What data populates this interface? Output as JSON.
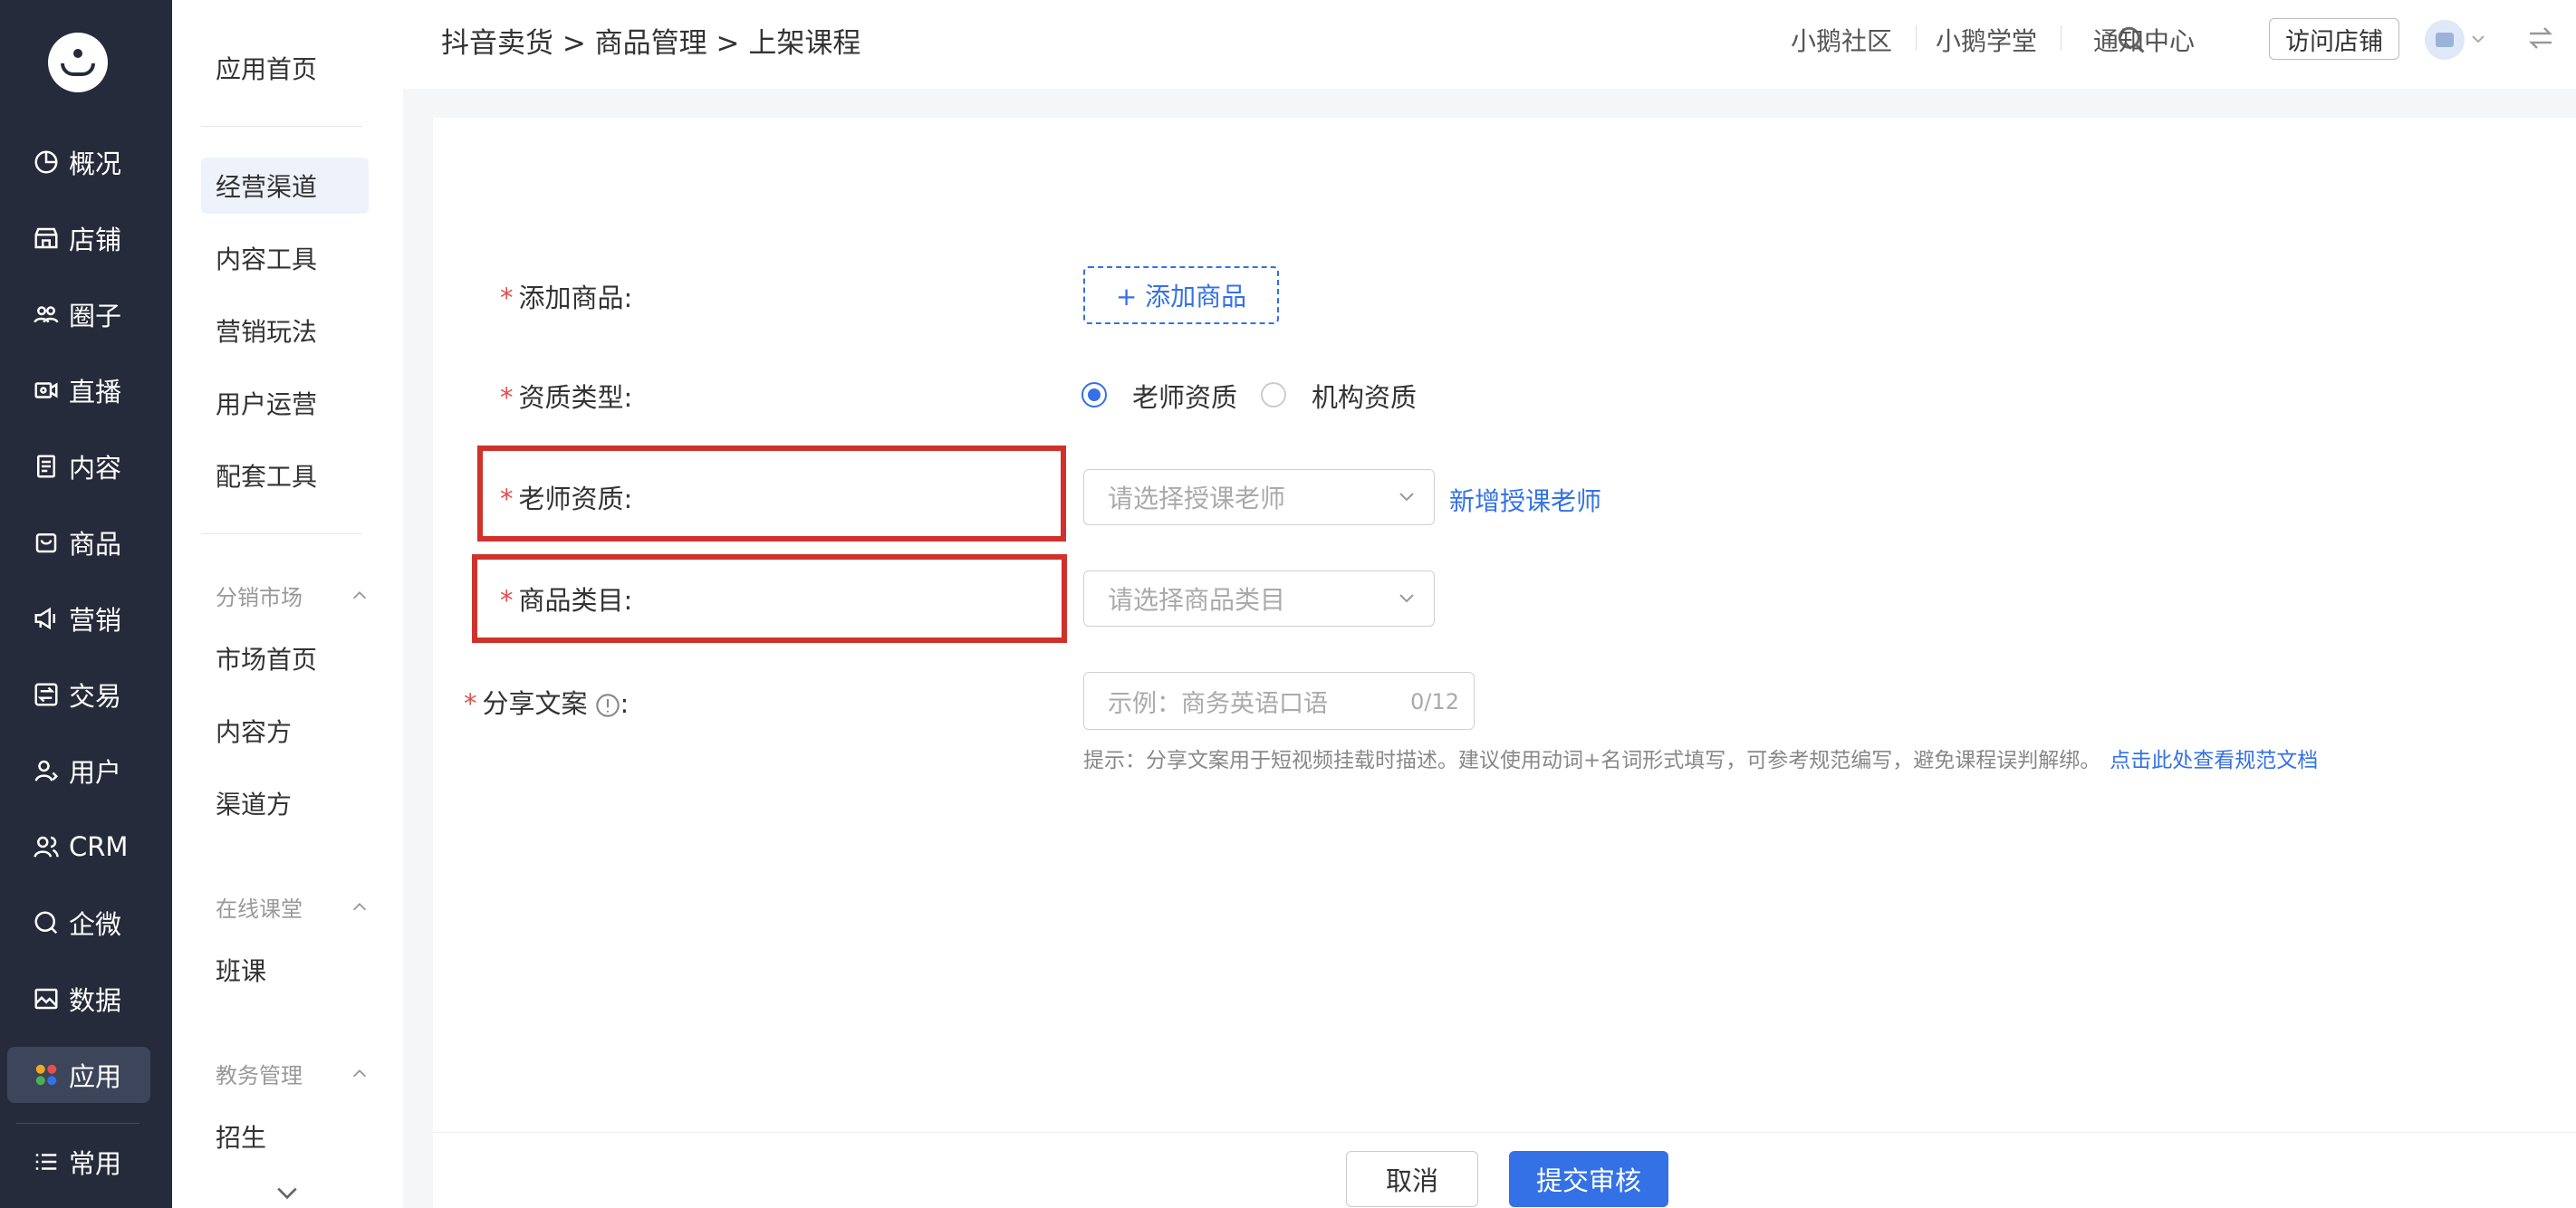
{
  "app": {
    "logo": "penguin-logo"
  },
  "leftnav": {
    "items": [
      {
        "label": "概况",
        "icon": "pie-chart-icon"
      },
      {
        "label": "店铺",
        "icon": "store-icon"
      },
      {
        "label": "圈子",
        "icon": "group-icon"
      },
      {
        "label": "直播",
        "icon": "live-camera-icon"
      },
      {
        "label": "内容",
        "icon": "document-icon"
      },
      {
        "label": "商品",
        "icon": "bag-icon"
      },
      {
        "label": "营销",
        "icon": "megaphone-icon"
      },
      {
        "label": "交易",
        "icon": "exchange-icon"
      },
      {
        "label": "用户",
        "icon": "user-icon"
      },
      {
        "label": "CRM",
        "icon": "users-icon"
      },
      {
        "label": "企微",
        "icon": "chat-search-icon"
      },
      {
        "label": "数据",
        "icon": "chart-image-icon"
      },
      {
        "label": "应用",
        "icon": "apps-icon",
        "active": true
      },
      {
        "label": "常用",
        "icon": "list-icon"
      }
    ]
  },
  "subnav": {
    "home": "应用首页",
    "items": [
      "经营渠道",
      "内容工具",
      "营销玩法",
      "用户运营",
      "配套工具"
    ],
    "active": "经营渠道",
    "groups": [
      {
        "title": "分销市场",
        "items": [
          "市场首页",
          "内容方",
          "渠道方"
        ]
      },
      {
        "title": "在线课堂",
        "items": [
          "班课"
        ]
      },
      {
        "title": "教务管理",
        "items": [
          "招生"
        ]
      }
    ]
  },
  "header": {
    "breadcrumb": "抖音卖货 > 商品管理 > 上架课程",
    "links": [
      "小鹅社区",
      "小鹅学堂",
      "通知中心"
    ],
    "visit_store": "访问店铺"
  },
  "form": {
    "add_product": {
      "label": "添加商品:",
      "button": "+ 添加商品"
    },
    "qualification": {
      "label": "资质类型:",
      "options": [
        "老师资质",
        "机构资质"
      ],
      "selected": "老师资质"
    },
    "teacher": {
      "label": "老师资质:",
      "placeholder": "请选择授课老师",
      "link": "新增授课老师"
    },
    "category": {
      "label": "商品类目:",
      "placeholder": "请选择商品类目"
    },
    "share": {
      "label": "分享文案",
      "colon": ":",
      "placeholder": "示例：商务英语口语",
      "count": "0/12",
      "hint": "提示：分享文案用于短视频挂载时描述。建议使用动词+名词形式填写，可参考规范编写，避免课程误判解绑。",
      "hint_link": "点击此处查看规范文档"
    },
    "required_mark": "*"
  },
  "footer": {
    "cancel": "取消",
    "submit": "提交审核"
  },
  "colors": {
    "primary": "#3471e6",
    "nav_bg": "#252b3a",
    "highlight": "#d0322b",
    "required": "#e34d4d"
  }
}
